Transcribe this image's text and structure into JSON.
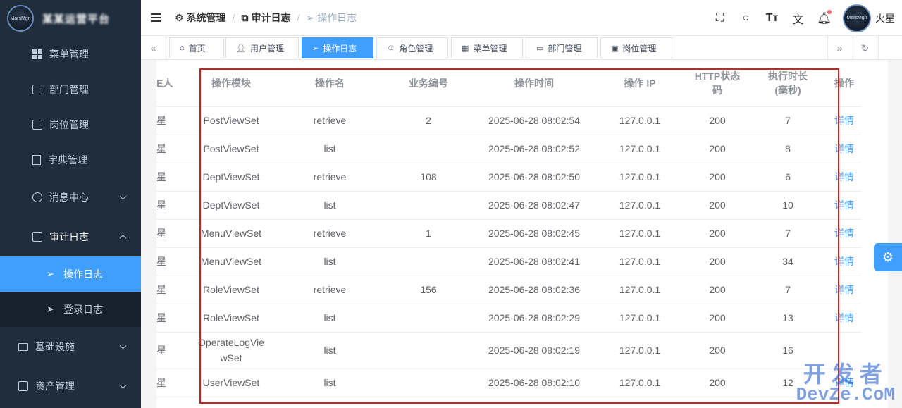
{
  "app": {
    "logo_text": "MarsMgn",
    "blurred_title": "某某运营平台"
  },
  "sidebar": {
    "items": [
      {
        "label": "菜单管理",
        "icon": "grid-icon"
      },
      {
        "label": "部门管理",
        "icon": "id-card-icon"
      },
      {
        "label": "岗位管理",
        "icon": "badge-icon"
      },
      {
        "label": "字典管理",
        "icon": "book-icon"
      },
      {
        "label": "消息中心",
        "icon": "chat-icon"
      },
      {
        "label": "审计日志",
        "icon": "copy-icon"
      },
      {
        "label": "操作日志",
        "icon": "send-icon"
      },
      {
        "label": "登录日志",
        "icon": "paper-plane-icon"
      },
      {
        "label": "基础设施",
        "icon": "monitor-icon"
      },
      {
        "label": "资产管理",
        "icon": "asset-icon"
      }
    ]
  },
  "header": {
    "breadcrumb": [
      "系统管理",
      "审计日志",
      "操作日志"
    ],
    "username": "火星"
  },
  "tags": [
    "首页",
    "用户管理",
    "操作日志",
    "角色管理",
    "菜单管理",
    "部门管理",
    "岗位管理"
  ],
  "table": {
    "headers": [
      "人",
      "操作模块",
      "操作名",
      "业务编号",
      "操作时间",
      "操作IP",
      "HTTP状态码",
      "执行时长(毫秒)",
      "操作"
    ],
    "header_display": {
      "h0": "E人",
      "h6a": "HTTP状态",
      "h6b": "码",
      "h7a": "执行时长",
      "h7b": "(毫秒)",
      "h5": "操作 IP"
    },
    "rows": [
      {
        "user": "星",
        "module": "PostViewSet",
        "name": "retrieve",
        "biz": "2",
        "time": "2025-06-28 08:02:54",
        "ip": "127.0.0.1",
        "status": "200",
        "duration": "7",
        "action": "详情"
      },
      {
        "user": "星",
        "module": "PostViewSet",
        "name": "list",
        "biz": "",
        "time": "2025-06-28 08:02:52",
        "ip": "127.0.0.1",
        "status": "200",
        "duration": "8",
        "action": "详情"
      },
      {
        "user": "星",
        "module": "DeptViewSet",
        "name": "retrieve",
        "biz": "108",
        "time": "2025-06-28 08:02:50",
        "ip": "127.0.0.1",
        "status": "200",
        "duration": "6",
        "action": "详情"
      },
      {
        "user": "星",
        "module": "DeptViewSet",
        "name": "list",
        "biz": "",
        "time": "2025-06-28 08:02:47",
        "ip": "127.0.0.1",
        "status": "200",
        "duration": "10",
        "action": "详情"
      },
      {
        "user": "星",
        "module": "MenuViewSet",
        "name": "retrieve",
        "biz": "1",
        "time": "2025-06-28 08:02:45",
        "ip": "127.0.0.1",
        "status": "200",
        "duration": "7",
        "action": "详情"
      },
      {
        "user": "星",
        "module": "MenuViewSet",
        "name": "list",
        "biz": "",
        "time": "2025-06-28 08:02:41",
        "ip": "127.0.0.1",
        "status": "200",
        "duration": "34",
        "action": "详情"
      },
      {
        "user": "星",
        "module": "RoleViewSet",
        "name": "retrieve",
        "biz": "156",
        "time": "2025-06-28 08:02:36",
        "ip": "127.0.0.1",
        "status": "200",
        "duration": "7",
        "action": "详情"
      },
      {
        "user": "星",
        "module": "RoleViewSet",
        "name": "list",
        "biz": "",
        "time": "2025-06-28 08:02:29",
        "ip": "127.0.0.1",
        "status": "200",
        "duration": "13",
        "action": "详情"
      },
      {
        "user": "星",
        "module": "OperateLogViewSet",
        "name": "list",
        "biz": "",
        "time": "2025-06-28 08:02:19",
        "ip": "127.0.0.1",
        "status": "200",
        "duration": "16",
        "action": ""
      },
      {
        "user": "星",
        "module": "UserViewSet",
        "name": "list",
        "biz": "",
        "time": "2025-06-28 08:02:10",
        "ip": "127.0.0.1",
        "status": "200",
        "duration": "12",
        "action": "详情"
      }
    ]
  },
  "watermark": {
    "line1": "开发者",
    "line2": "DevZe.CoM"
  },
  "colors": {
    "sidebar_bg": "#1f2d3d",
    "accent": "#409eff",
    "highlight_border": "#d7201e"
  }
}
